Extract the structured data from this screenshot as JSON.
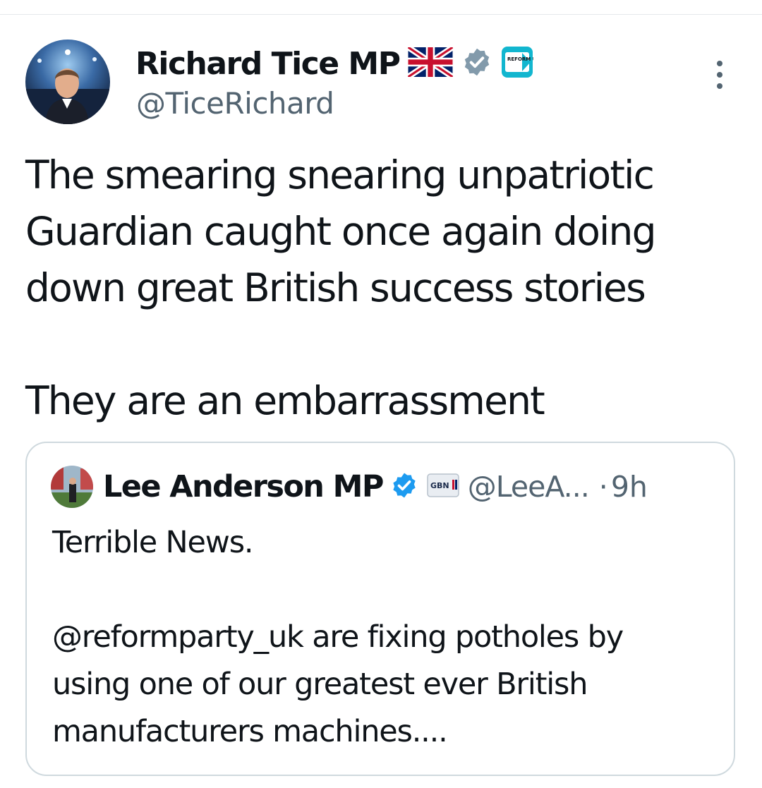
{
  "tweet": {
    "author": {
      "display_name": "Richard Tice MP",
      "flag_emoji": "🇬🇧",
      "verified_icon": "verified-badge-icon",
      "affiliation_badge_text": "REFORM UK",
      "handle": "@TiceRichard"
    },
    "more_icon": "more-options-icon",
    "text": "The smearing snearing unpatriotic\nGuardian caught once again doing\ndown great British success stories\n\nThey are an embarrassment",
    "quoted_tweet": {
      "display_name": "Lee Anderson MP",
      "verified_icon": "verified-badge-icon",
      "affiliation_badge_text": "GBN",
      "handle": "@LeeA...",
      "separator": "·",
      "time": "9h",
      "text": "Terrible News.\n\n@reformparty_uk are fixing potholes by\nusing one of our greatest ever British\nmanufacturers machines...."
    }
  },
  "colors": {
    "text_primary": "#0f1419",
    "text_secondary": "#536471",
    "border": "#cfd9de",
    "verified_gray": "#829aab",
    "verified_blue": "#1d9bf0",
    "reform_cyan": "#12b6cf"
  }
}
